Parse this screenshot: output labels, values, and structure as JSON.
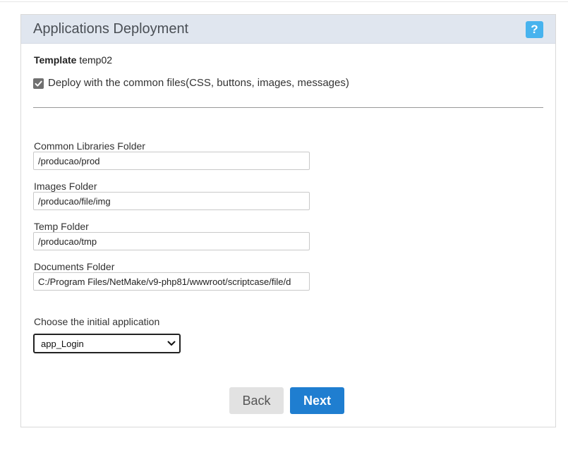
{
  "header": {
    "title": "Applications Deployment",
    "help_label": "?"
  },
  "template": {
    "label": "Template",
    "value": "temp02"
  },
  "deploy_common": {
    "checked": true,
    "label": "Deploy with the common files(CSS, buttons, images, messages)"
  },
  "fields": {
    "common_libraries": {
      "label": "Common Libraries Folder",
      "value": "/producao/prod"
    },
    "images": {
      "label": "Images Folder",
      "value": "/producao/file/img"
    },
    "temp": {
      "label": "Temp Folder",
      "value": "/producao/tmp"
    },
    "documents": {
      "label": "Documents Folder",
      "value": "C:/Program Files/NetMake/v9-php81/wwwroot/scriptcase/file/d"
    }
  },
  "initial_app": {
    "label": "Choose the initial application",
    "selected": "app_Login"
  },
  "buttons": {
    "back": "Back",
    "next": "Next"
  },
  "colors": {
    "header_bg": "#e0e6ef",
    "help_bg": "#47b3ee",
    "next_bg": "#1f7ed0",
    "back_bg": "#e2e2e2"
  }
}
